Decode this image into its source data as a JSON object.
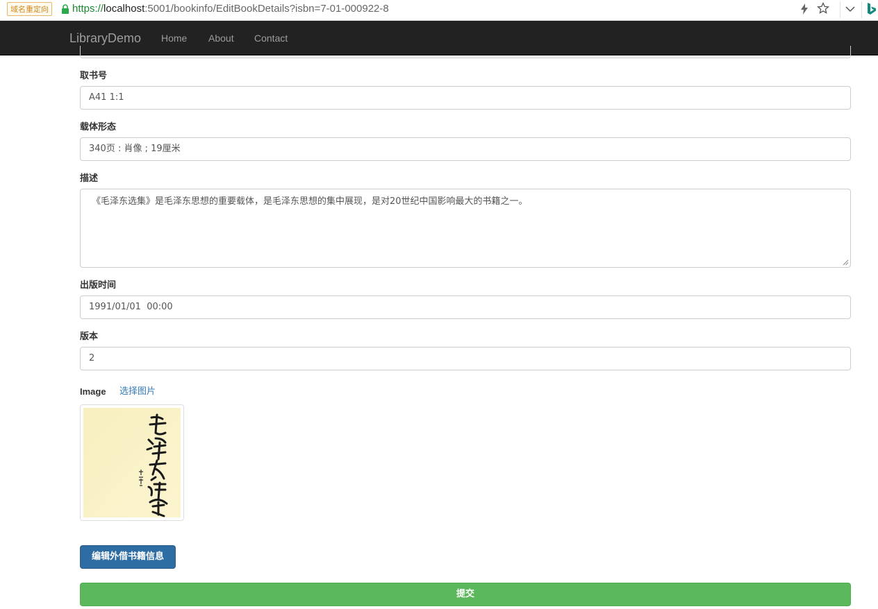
{
  "browser": {
    "redirect_badge": "域名重定向",
    "url_scheme": "https://",
    "url_host": "localhost",
    "url_rest": ":5001/bookinfo/EditBookDetails?isbn=7-01-000922-8"
  },
  "navbar": {
    "brand": "LibraryDemo",
    "links": [
      "Home",
      "About",
      "Contact"
    ]
  },
  "form": {
    "call_number": {
      "label": "取书号",
      "value": "A41 1:1"
    },
    "physical_form": {
      "label": "载体形态",
      "value": "340页 : 肖像 ; 19厘米"
    },
    "description": {
      "label": "描述",
      "value": "《毛泽东选集》是毛泽东思想的重要载体，是毛泽东思想的集中展现，是对20世纪中国影响最大的书籍之一。"
    },
    "publish_date": {
      "label": "出版时间",
      "value": "1991/01/01  00:00"
    },
    "edition": {
      "label": "版本",
      "value": "2"
    },
    "image": {
      "label": "Image",
      "choose_link": "选择图片"
    },
    "edit_lending_button": "编辑外借书籍信息",
    "submit_button": "提交"
  },
  "colors": {
    "navbar_bg": "#222222",
    "primary": "#2e6da4",
    "success": "#5cb85c",
    "link": "#337ab7"
  }
}
